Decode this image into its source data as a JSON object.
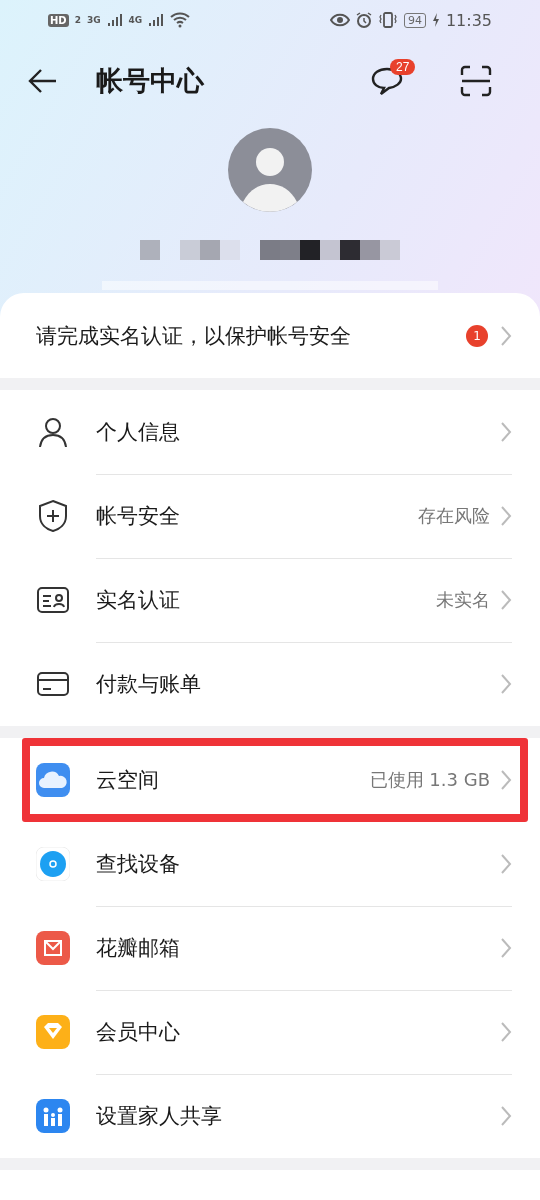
{
  "status_bar": {
    "hd": "HD",
    "sim": "2",
    "network_1": "3G",
    "network_2": "4G",
    "battery": "94",
    "time": "11:35"
  },
  "header": {
    "title": "帐号中心",
    "messages_badge": "27"
  },
  "notice": {
    "text": "请完成实名认证，以保护帐号安全",
    "badge": "1"
  },
  "groups": [
    {
      "items": [
        {
          "kind": "person",
          "label": "个人信息",
          "highlighted": false
        },
        {
          "kind": "shield",
          "label": "帐号安全",
          "value": "存在风险",
          "highlighted": false
        },
        {
          "kind": "idcard",
          "label": "实名认证",
          "value": "未实名",
          "highlighted": false
        },
        {
          "kind": "card",
          "label": "付款与账单",
          "highlighted": false
        }
      ]
    },
    {
      "items": [
        {
          "kind": "cloud",
          "label": "云空间",
          "value": "已使用 1.3 GB",
          "highlighted": true
        },
        {
          "kind": "find",
          "label": "查找设备",
          "highlighted": false
        },
        {
          "kind": "mail",
          "label": "花瓣邮箱",
          "highlighted": false
        },
        {
          "kind": "vip",
          "label": "会员中心",
          "highlighted": false
        },
        {
          "kind": "family",
          "label": "设置家人共享",
          "highlighted": false
        }
      ]
    }
  ]
}
